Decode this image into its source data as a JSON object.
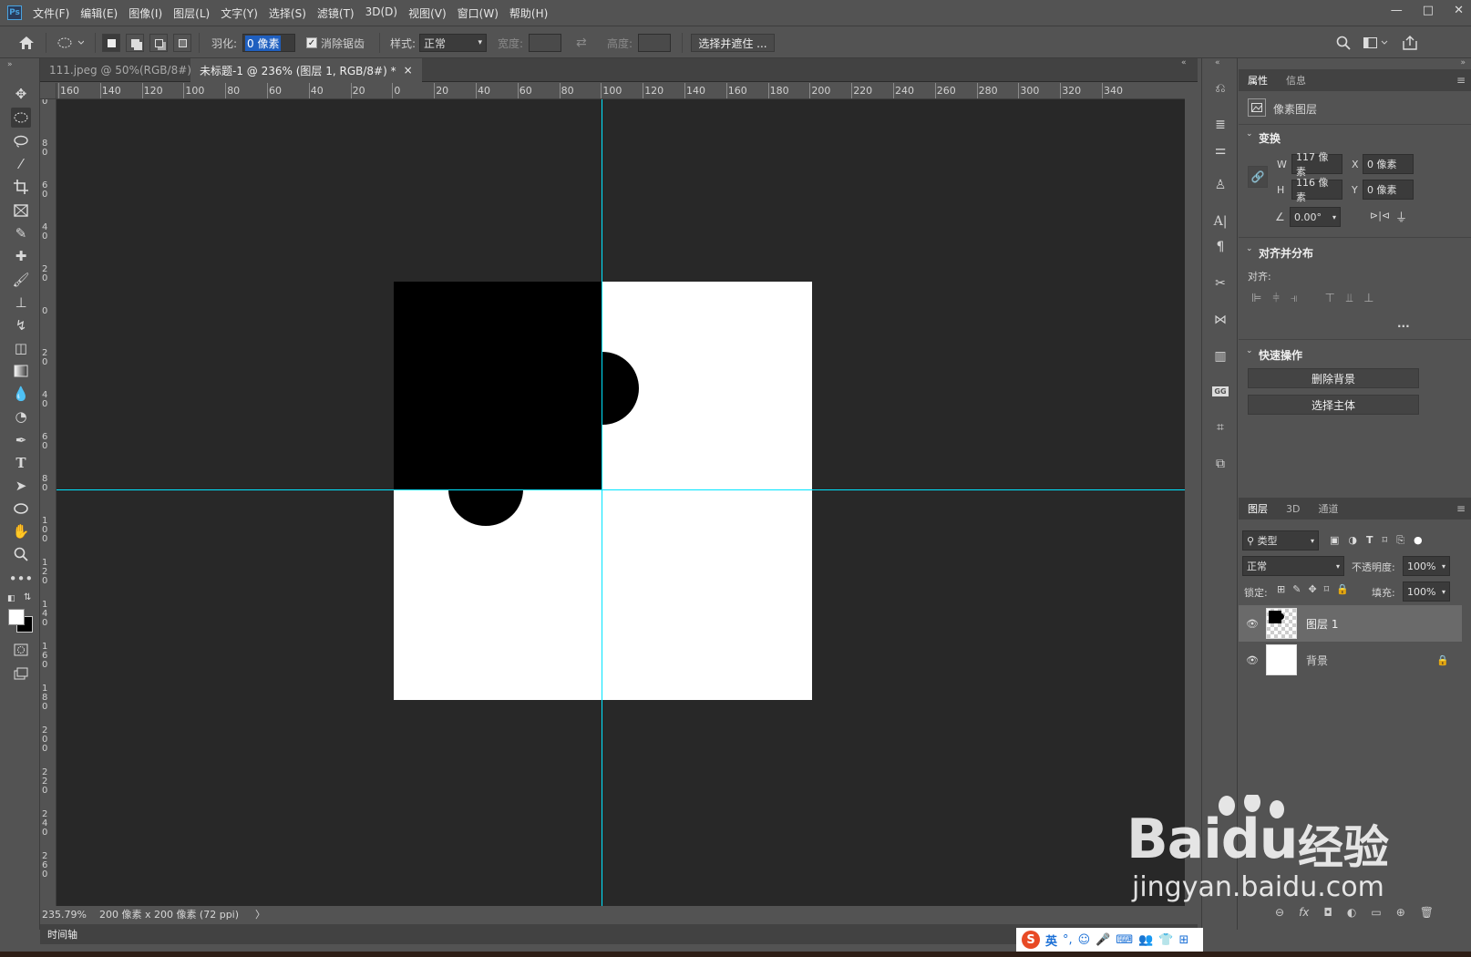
{
  "app": {
    "logo": "Ps"
  },
  "menu": [
    "文件(F)",
    "编辑(E)",
    "图像(I)",
    "图层(L)",
    "文字(Y)",
    "选择(S)",
    "滤镜(T)",
    "3D(D)",
    "视图(V)",
    "窗口(W)",
    "帮助(H)"
  ],
  "window_controls": [
    "—",
    "□",
    "✕"
  ],
  "options": {
    "feather_label": "羽化:",
    "feather_value": "0 像素",
    "antialias_label": "消除锯齿",
    "style_label": "样式:",
    "style_value": "正常",
    "width_label": "宽度:",
    "height_label": "高度:",
    "select_mask_button": "选择并遮住 ..."
  },
  "tabs": [
    {
      "label": "111.jpeg @ 50%(RGB/8#)",
      "close": "×",
      "active": false
    },
    {
      "label": "未标题-1 @ 236% (图层 1, RGB/8#) *",
      "close": "×",
      "active": true
    }
  ],
  "ruler_top": [
    "160",
    "140",
    "120",
    "100",
    "80",
    "60",
    "40",
    "20",
    "0",
    "20",
    "40",
    "60",
    "80",
    "100",
    "120",
    "140",
    "160",
    "180",
    "200",
    "220",
    "240",
    "260",
    "280",
    "300",
    "320",
    "340"
  ],
  "ruler_left": [
    "0",
    "8 0",
    "6 0",
    "4 0",
    "2 0",
    "0",
    "2 0",
    "4 0",
    "6 0",
    "8 0",
    "1 0 0",
    "1 2 0",
    "1 4 0",
    "1 6 0",
    "1 8 0",
    "2 0 0",
    "2 2 0",
    "2 4 0",
    "2 6 0"
  ],
  "status": {
    "zoom": "235.79%",
    "doc_info": "200 像素 x 200 像素 (72 ppi)",
    "arrow": "〉"
  },
  "timeline_label": "时间轴",
  "properties": {
    "tabs": [
      "属性",
      "信息"
    ],
    "layer_type": "像素图层",
    "transform_title": "变换",
    "w_label": "W",
    "w_value": "117 像素",
    "x_label": "X",
    "x_value": "0 像素",
    "h_label": "H",
    "h_value": "116 像素",
    "y_label": "Y",
    "y_value": "0 像素",
    "angle_value": "0.00°",
    "align_title": "对齐并分布",
    "align_label": "对齐:",
    "more": "...",
    "quick_title": "快速操作",
    "remove_bg_button": "删除背景",
    "select_subject_button": "选择主体"
  },
  "layers": {
    "tabs": [
      "图层",
      "3D",
      "通道"
    ],
    "filter_value": "类型",
    "blend_mode": "正常",
    "opacity_label": "不透明度:",
    "opacity_value": "100%",
    "lock_label": "锁定:",
    "fill_label": "填充:",
    "fill_value": "100%",
    "items": [
      {
        "name": "图层 1",
        "selected": true
      },
      {
        "name": "背景",
        "selected": false
      }
    ]
  },
  "ime": {
    "logo": "S",
    "lang": "英"
  },
  "watermark": {
    "brand": "Bai",
    "brand2": "du",
    "title": "经验",
    "url": "jingyan.baidu.com"
  },
  "colors": {
    "guide": "#00e5ff",
    "canvas_bg": "#282828",
    "ui_bg": "#535353"
  }
}
